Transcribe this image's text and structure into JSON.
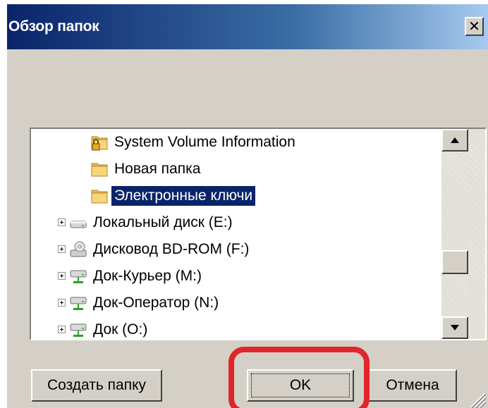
{
  "window": {
    "title": "Обзор папок",
    "close_glyph": "✕"
  },
  "tree": {
    "items": [
      {
        "label": "System Volume Information",
        "icon": "locked-folder-icon",
        "expandable": false,
        "selected": false
      },
      {
        "label": "Новая папка",
        "icon": "folder-icon",
        "expandable": false,
        "selected": false
      },
      {
        "label": "Электронные ключи",
        "icon": "folder-icon",
        "expandable": false,
        "selected": true
      },
      {
        "label": "Локальный диск (E:)",
        "icon": "hard-drive-icon",
        "expandable": true,
        "selected": false
      },
      {
        "label": "Дисковод BD-ROM (F:)",
        "icon": "optical-drive-icon",
        "expandable": true,
        "selected": false
      },
      {
        "label": "Док-Курьер (M:)",
        "icon": "network-drive-icon",
        "expandable": true,
        "selected": false
      },
      {
        "label": "Док-Оператор (N:)",
        "icon": "network-drive-icon",
        "expandable": true,
        "selected": false
      },
      {
        "label": "Док (O:)",
        "icon": "network-drive-icon",
        "expandable": true,
        "selected": false
      }
    ]
  },
  "buttons": {
    "create_folder": "Создать папку",
    "ok": "OK",
    "cancel": "Отмена"
  },
  "colors": {
    "selection": "#0a246a",
    "highlight_ring": "#e0262b",
    "dialog_face": "#d4d0c8"
  }
}
